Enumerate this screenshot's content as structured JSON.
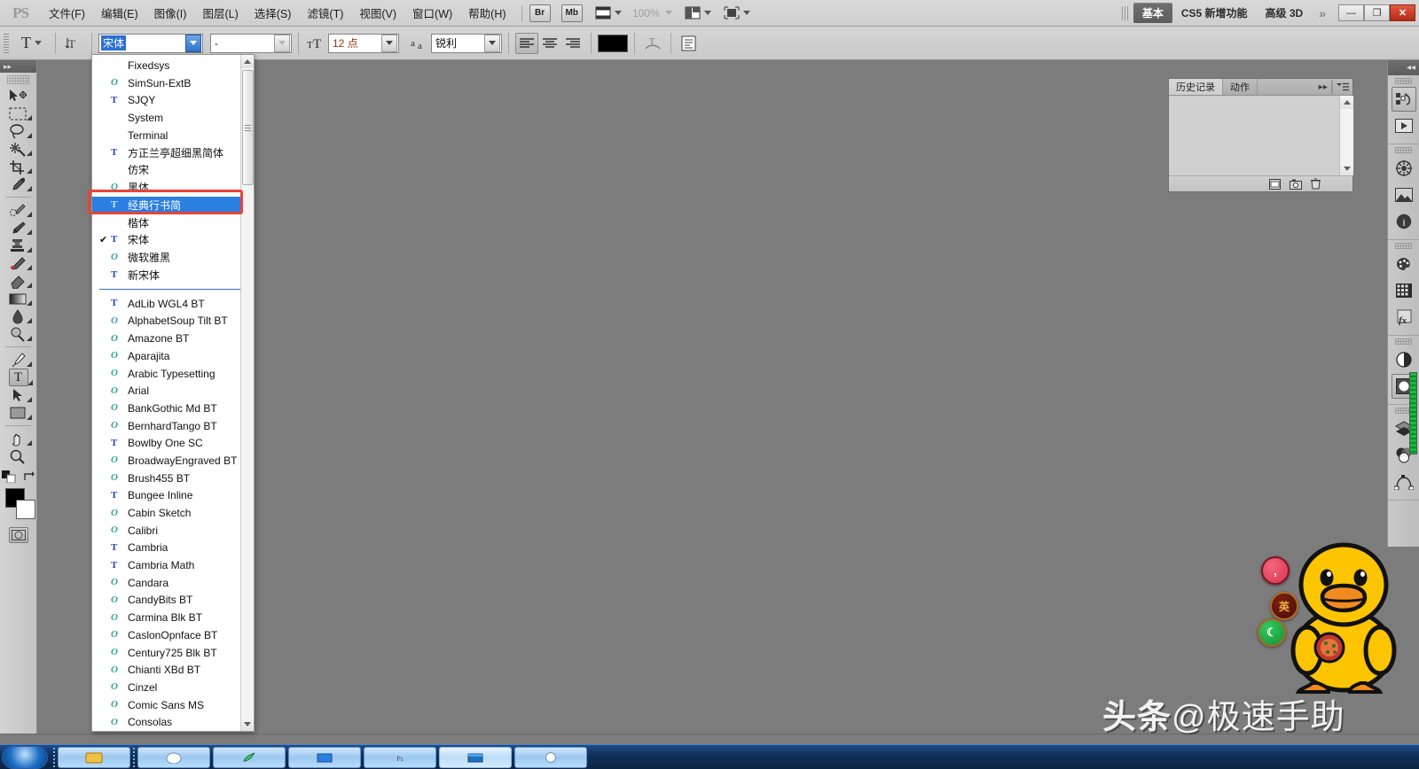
{
  "app": {
    "name": "Adobe Photoshop CS5",
    "logo": "PS"
  },
  "menubar": {
    "items": [
      {
        "label": "文件(F)",
        "name": "menu-file"
      },
      {
        "label": "编辑(E)",
        "name": "menu-edit"
      },
      {
        "label": "图像(I)",
        "name": "menu-image"
      },
      {
        "label": "图层(L)",
        "name": "menu-layer"
      },
      {
        "label": "选择(S)",
        "name": "menu-select"
      },
      {
        "label": "滤镜(T)",
        "name": "menu-filter"
      },
      {
        "label": "视图(V)",
        "name": "menu-view"
      },
      {
        "label": "窗口(W)",
        "name": "menu-window"
      },
      {
        "label": "帮助(H)",
        "name": "menu-help"
      }
    ],
    "bridge_label": "Br",
    "minibridge_label": "Mb",
    "zoom_level": "100%",
    "workspace_tabs": [
      {
        "label": "基本",
        "active": true
      },
      {
        "label": "CS5 新增功能",
        "active": false
      },
      {
        "label": "高级 3D",
        "active": false
      }
    ],
    "overflow_label": "»",
    "window_controls": {
      "minimize": "—",
      "restore": "❐",
      "close": "✕"
    }
  },
  "optionsbar": {
    "tool_glyph": "T",
    "orientation_icon": "text-orientation-icon",
    "font_family_value": "宋体",
    "font_style_value": "-",
    "font_size_icon": "TT",
    "font_size_value": "12 点",
    "antialias_icon": "aa",
    "antialias_value": "锐利",
    "align": [
      "align-left",
      "align-center",
      "align-right"
    ],
    "align_selected": 0,
    "color_swatch": "#000000",
    "warp_icon": "warp-text-icon",
    "panel_icon": "toggle-char-panel-icon"
  },
  "toolbar": {
    "tools": [
      {
        "name": "move-tool",
        "glyph": "✥",
        "sub": false
      },
      {
        "name": "rectangular-marquee-tool",
        "glyph": "▭",
        "sub": true
      },
      {
        "name": "lasso-tool",
        "glyph": "◯",
        "sub": true
      },
      {
        "name": "quick-selection-tool",
        "glyph": "✳",
        "sub": true
      },
      {
        "name": "crop-tool",
        "glyph": "⌗",
        "sub": true
      },
      {
        "name": "eyedropper-tool",
        "glyph": "⌇",
        "sub": true
      },
      {
        "name": "spot-healing-brush-tool",
        "glyph": "✎",
        "sub": true
      },
      {
        "name": "brush-tool",
        "glyph": "🖌",
        "sub": true
      },
      {
        "name": "clone-stamp-tool",
        "glyph": "⎙",
        "sub": true
      },
      {
        "name": "history-brush-tool",
        "glyph": "✒",
        "sub": true
      },
      {
        "name": "eraser-tool",
        "glyph": "▰",
        "sub": true
      },
      {
        "name": "gradient-tool",
        "glyph": "▤",
        "sub": true
      },
      {
        "name": "blur-tool",
        "glyph": "💧",
        "sub": true
      },
      {
        "name": "dodge-tool",
        "glyph": "◐",
        "sub": true
      },
      {
        "name": "pen-tool",
        "glyph": "✑",
        "sub": true
      },
      {
        "name": "horizontal-type-tool",
        "glyph": "T",
        "sub": true,
        "selected": true
      },
      {
        "name": "path-selection-tool",
        "glyph": "➤",
        "sub": true
      },
      {
        "name": "rectangle-tool",
        "glyph": "▢",
        "sub": true
      },
      {
        "name": "hand-tool",
        "glyph": "✋",
        "sub": true
      },
      {
        "name": "zoom-tool",
        "glyph": "🔍",
        "sub": false
      }
    ],
    "foreground_color": "#000000",
    "background_color": "#ffffff",
    "quickmask_icon": "quick-mask-icon"
  },
  "font_menu": {
    "scroll_position": "top",
    "installed_section": [
      {
        "name": "Fixedsys",
        "icon": "none",
        "checked": false
      },
      {
        "name": "SimSun-ExtB",
        "icon": "ot",
        "checked": false
      },
      {
        "name": "SJQY",
        "icon": "tt",
        "checked": false
      },
      {
        "name": "System",
        "icon": "none",
        "checked": false
      },
      {
        "name": "Terminal",
        "icon": "none",
        "checked": false
      },
      {
        "name": "方正兰亭超细黑简体",
        "icon": "tt",
        "checked": false
      },
      {
        "name": "仿宋",
        "icon": "none",
        "checked": false
      },
      {
        "name": "黑体",
        "icon": "ot",
        "checked": false
      },
      {
        "name": "经典行书简",
        "icon": "tt",
        "checked": false,
        "highlighted": true
      },
      {
        "name": "楷体",
        "icon": "none",
        "checked": false
      },
      {
        "name": "宋体",
        "icon": "tt",
        "checked": true
      },
      {
        "name": "微软雅黑",
        "icon": "ot",
        "checked": false
      },
      {
        "name": "新宋体",
        "icon": "tt",
        "checked": false
      }
    ],
    "all_fonts_section": [
      {
        "name": "AdLib WGL4 BT",
        "icon": "tt"
      },
      {
        "name": "AlphabetSoup Tilt BT",
        "icon": "ot"
      },
      {
        "name": "Amazone BT",
        "icon": "ot"
      },
      {
        "name": "Aparajita",
        "icon": "ot"
      },
      {
        "name": "Arabic Typesetting",
        "icon": "ot"
      },
      {
        "name": "Arial",
        "icon": "ot"
      },
      {
        "name": "BankGothic Md BT",
        "icon": "ot"
      },
      {
        "name": "BernhardTango BT",
        "icon": "ot"
      },
      {
        "name": "Bowlby One SC",
        "icon": "tt"
      },
      {
        "name": "BroadwayEngraved BT",
        "icon": "ot"
      },
      {
        "name": "Brush455 BT",
        "icon": "ot"
      },
      {
        "name": "Bungee Inline",
        "icon": "tt"
      },
      {
        "name": "Cabin Sketch",
        "icon": "ot"
      },
      {
        "name": "Calibri",
        "icon": "ot"
      },
      {
        "name": "Cambria",
        "icon": "tt"
      },
      {
        "name": "Cambria Math",
        "icon": "tt"
      },
      {
        "name": "Candara",
        "icon": "ot"
      },
      {
        "name": "CandyBits BT",
        "icon": "ot"
      },
      {
        "name": "Carmina Blk BT",
        "icon": "ot"
      },
      {
        "name": "CaslonOpnface BT",
        "icon": "ot"
      },
      {
        "name": "Century725 Blk BT",
        "icon": "ot"
      },
      {
        "name": "Chianti XBd BT",
        "icon": "ot"
      },
      {
        "name": "Cinzel",
        "icon": "ot"
      },
      {
        "name": "Comic Sans MS",
        "icon": "ot"
      },
      {
        "name": "Consolas",
        "icon": "ot"
      }
    ],
    "highlight_color": "#2b7fe0",
    "annotation_box_color": "#e8443a"
  },
  "history_panel": {
    "tabs": [
      {
        "label": "历史记录",
        "active": true
      },
      {
        "label": "动作",
        "active": false
      }
    ],
    "collapse_icon": "double-chevron-right-icon",
    "menu_icon": "panel-menu-icon",
    "footer_buttons": [
      {
        "name": "create-document-from-state-icon",
        "glyph": "▤"
      },
      {
        "name": "create-snapshot-icon",
        "glyph": "▣"
      },
      {
        "name": "delete-state-icon",
        "glyph": "🗑"
      }
    ]
  },
  "icon_dock": {
    "collapse_icon": "double-chevron-left-icon",
    "groups": [
      {
        "icons": [
          {
            "name": "history-panel-icon",
            "glyph": "↺",
            "active": true
          },
          {
            "name": "actions-panel-icon",
            "glyph": "▶",
            "active": false
          }
        ]
      },
      {
        "icons": [
          {
            "name": "adjustments-panel-icon",
            "glyph": "✸",
            "active": false
          },
          {
            "name": "masks-panel-icon",
            "glyph": "⛰",
            "active": false
          },
          {
            "name": "info-panel-icon",
            "glyph": "i",
            "active": false
          }
        ]
      },
      {
        "icons": [
          {
            "name": "color-panel-icon",
            "glyph": "🎨",
            "active": false
          },
          {
            "name": "swatches-panel-icon",
            "glyph": "▦",
            "active": false
          },
          {
            "name": "styles-panel-icon",
            "glyph": "fx",
            "active": false
          }
        ]
      },
      {
        "icons": [
          {
            "name": "adjustment-layer-icon",
            "glyph": "◑",
            "active": false
          },
          {
            "name": "mask-icon",
            "glyph": "◉",
            "active": true
          }
        ]
      },
      {
        "icons": [
          {
            "name": "layers-panel-icon",
            "glyph": "◆",
            "active": false
          },
          {
            "name": "channels-panel-icon",
            "glyph": "◓",
            "active": false
          },
          {
            "name": "paths-panel-icon",
            "glyph": "⌂",
            "active": false
          }
        ]
      }
    ]
  },
  "ime_buttons": [
    {
      "name": "ime-punctuation-button",
      "label": ",",
      "color": "#d8344f"
    },
    {
      "name": "ime-english-button",
      "label": "英",
      "color": "#4a0d06"
    },
    {
      "name": "ime-mode-button",
      "label": "☾",
      "color": "#13922f"
    }
  ],
  "watermark": {
    "brand": "头条",
    "handle": "@极速手助"
  },
  "taskbar": {
    "start_label": "start",
    "items": [
      {
        "name": "taskbar-item-1",
        "active": false
      },
      {
        "name": "taskbar-item-2",
        "active": false
      },
      {
        "name": "taskbar-item-3",
        "active": false
      },
      {
        "name": "taskbar-item-4",
        "active": false
      },
      {
        "name": "taskbar-item-5",
        "active": false
      },
      {
        "name": "taskbar-item-6",
        "active": true
      },
      {
        "name": "taskbar-item-7",
        "active": false
      }
    ]
  }
}
